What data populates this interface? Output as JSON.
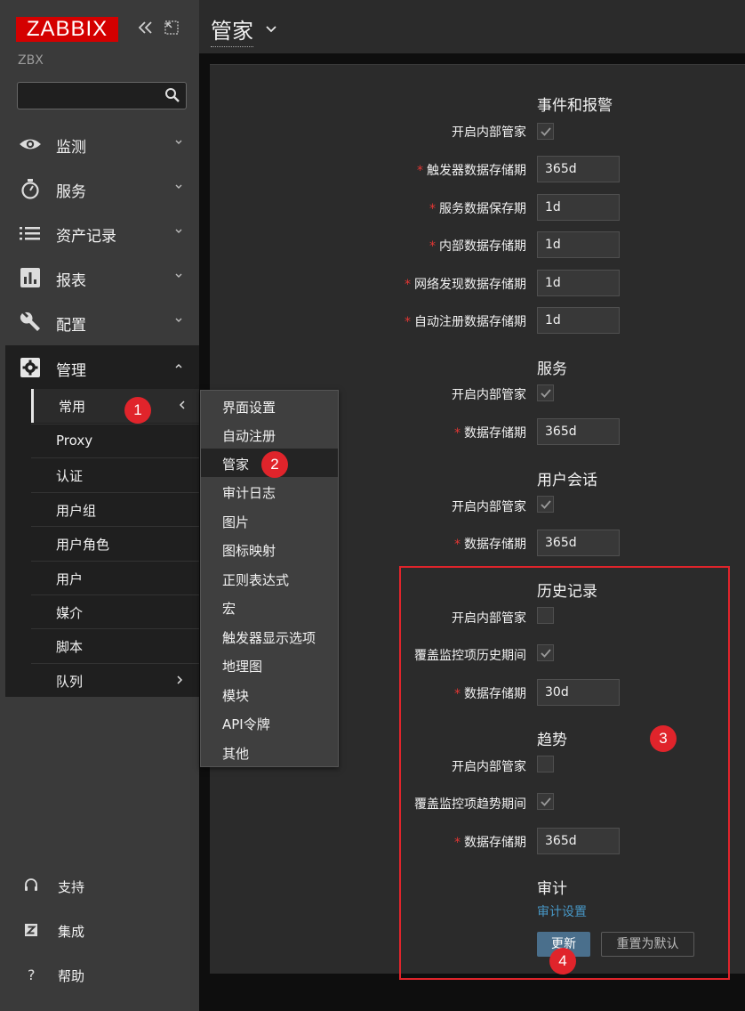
{
  "app": {
    "logo": "ZABBIX",
    "instance": "ZBX"
  },
  "search": {
    "placeholder": ""
  },
  "nav": {
    "monitoring": "监测",
    "services": "服务",
    "inventory": "资产记录",
    "reports": "报表",
    "config": "配置",
    "admin": "管理"
  },
  "admin_sub": {
    "general": "常用",
    "proxy": "Proxy",
    "auth": "认证",
    "usergroups": "用户组",
    "roles": "用户角色",
    "users": "用户",
    "media": "媒介",
    "scripts": "脚本",
    "queue": "队列"
  },
  "flyout": [
    "界面设置",
    "自动注册",
    "管家",
    "审计日志",
    "图片",
    "图标映射",
    "正则表达式",
    "宏",
    "触发器显示选项",
    "地理图",
    "模块",
    "API令牌",
    "其他"
  ],
  "footer": {
    "support": "支持",
    "integrations": "集成",
    "help": "帮助"
  },
  "header": {
    "title": "管家"
  },
  "form": {
    "events": {
      "title": "事件和报警",
      "enable": "开启内部管家",
      "trigger": "触发器数据存储期",
      "trigger_val": "365d",
      "service": "服务数据保存期",
      "service_val": "1d",
      "internal": "内部数据存储期",
      "internal_val": "1d",
      "discovery": "网络发现数据存储期",
      "discovery_val": "1d",
      "autoreg": "自动注册数据存储期",
      "autoreg_val": "1d"
    },
    "services": {
      "title": "服务",
      "enable": "开启内部管家",
      "period": "数据存储期",
      "period_val": "365d"
    },
    "sessions": {
      "title": "用户会话",
      "enable": "开启内部管家",
      "period": "数据存储期",
      "period_val": "365d"
    },
    "history": {
      "title": "历史记录",
      "enable": "开启内部管家",
      "override": "覆盖监控项历史期间",
      "period": "数据存储期",
      "period_val": "30d"
    },
    "trends": {
      "title": "趋势",
      "enable": "开启内部管家",
      "override": "覆盖监控项趋势期间",
      "period": "数据存储期",
      "period_val": "365d"
    },
    "audit": {
      "title": "审计",
      "link": "审计设置"
    },
    "update_btn": "更新",
    "reset_btn": "重置为默认",
    "required_mark": "*"
  },
  "annotations": [
    "1",
    "2",
    "3",
    "4"
  ],
  "colors": {
    "brand": "#d40000",
    "annotation": "#e0242b",
    "link": "#4796c4",
    "primary_button": "#4a6f8c"
  }
}
